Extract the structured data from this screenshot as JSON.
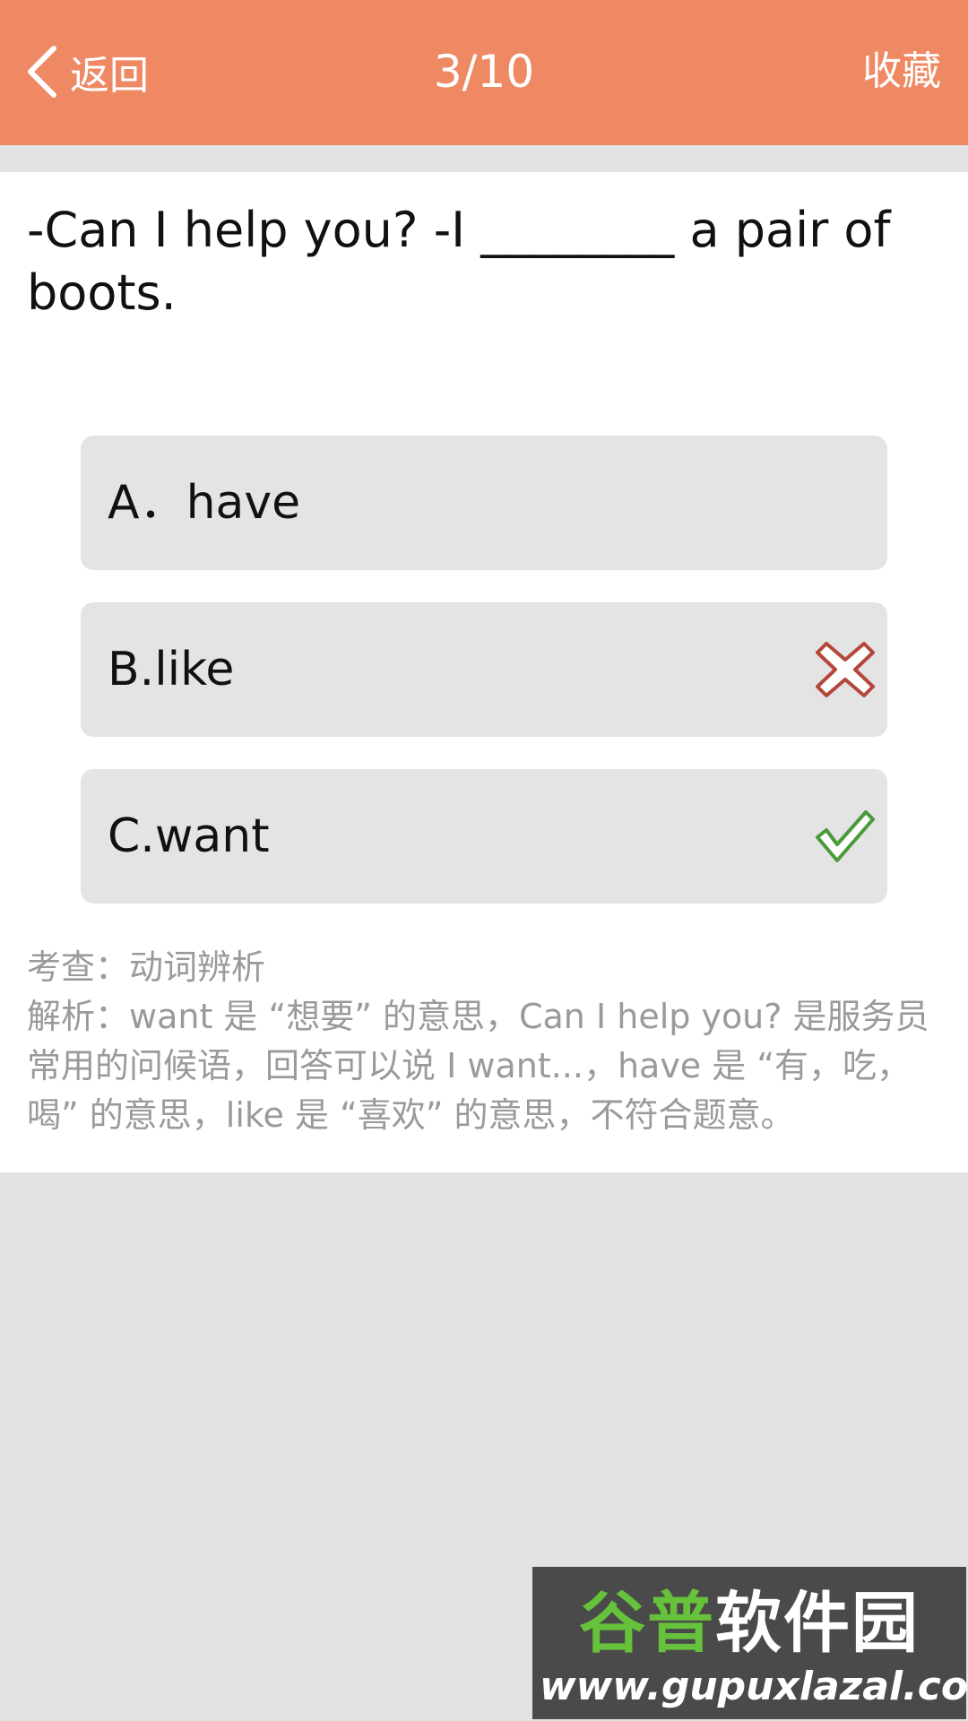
{
  "header": {
    "back_label": "返回",
    "progress": "3/10",
    "favorite_label": "收藏",
    "background_color": "#ee8963"
  },
  "question": {
    "text": "-Can I help you? -I ________ a pair of boots."
  },
  "options": [
    {
      "label": "A．have",
      "status": "none"
    },
    {
      "label": "B.like",
      "status": "wrong",
      "icon": "cross-icon",
      "color": "#b5473a"
    },
    {
      "label": "C.want",
      "status": "correct",
      "icon": "check-icon",
      "color": "#4a9a3a"
    }
  ],
  "analysis": {
    "topic": "考查：动词辨析",
    "explanation": "解析：want 是 “想要” 的意思，Can I help you? 是服务员常用的问候语，回答可以说 I want...，have 是 “有，吃，喝” 的意思，like 是 “喜欢” 的意思，不符合题意。"
  },
  "watermark": {
    "logo_part1": "谷普",
    "logo_part2": "软件园",
    "url": "www.gupuxlazal.com"
  }
}
